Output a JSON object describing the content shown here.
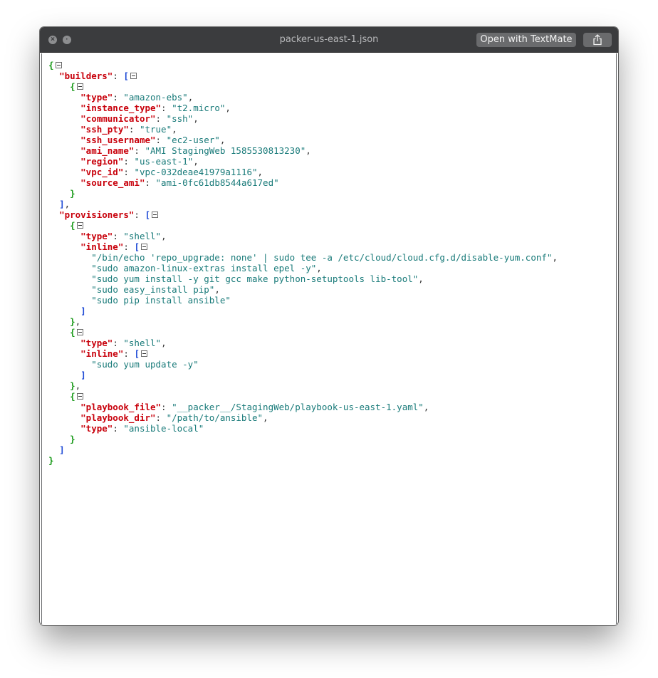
{
  "window": {
    "title": "packer-us-east-1.json",
    "open_with_label": "Open with TextMate",
    "close_icon": "close-icon",
    "minimize_icon": "minimize-icon",
    "share_icon": "share-icon"
  },
  "lines": [
    {
      "indent": 0,
      "tokens": [
        {
          "c": "bc",
          "t": "{"
        },
        {
          "tog": true
        }
      ]
    },
    {
      "indent": 1,
      "tokens": [
        {
          "c": "k",
          "t": "\"builders\""
        },
        {
          "c": "p",
          "t": ": "
        },
        {
          "c": "bs",
          "t": "["
        },
        {
          "tog": true
        }
      ]
    },
    {
      "indent": 2,
      "tokens": [
        {
          "c": "bc",
          "t": "{"
        },
        {
          "tog": true
        }
      ]
    },
    {
      "indent": 3,
      "tokens": [
        {
          "c": "k",
          "t": "\"type\""
        },
        {
          "c": "p",
          "t": ": "
        },
        {
          "c": "s",
          "t": "\"amazon-ebs\""
        },
        {
          "c": "p",
          "t": ","
        }
      ]
    },
    {
      "indent": 3,
      "tokens": [
        {
          "c": "k",
          "t": "\"instance_type\""
        },
        {
          "c": "p",
          "t": ": "
        },
        {
          "c": "s",
          "t": "\"t2.micro\""
        },
        {
          "c": "p",
          "t": ","
        }
      ]
    },
    {
      "indent": 3,
      "tokens": [
        {
          "c": "k",
          "t": "\"communicator\""
        },
        {
          "c": "p",
          "t": ": "
        },
        {
          "c": "s",
          "t": "\"ssh\""
        },
        {
          "c": "p",
          "t": ","
        }
      ]
    },
    {
      "indent": 3,
      "tokens": [
        {
          "c": "k",
          "t": "\"ssh_pty\""
        },
        {
          "c": "p",
          "t": ": "
        },
        {
          "c": "s",
          "t": "\"true\""
        },
        {
          "c": "p",
          "t": ","
        }
      ]
    },
    {
      "indent": 3,
      "tokens": [
        {
          "c": "k",
          "t": "\"ssh_username\""
        },
        {
          "c": "p",
          "t": ": "
        },
        {
          "c": "s",
          "t": "\"ec2-user\""
        },
        {
          "c": "p",
          "t": ","
        }
      ]
    },
    {
      "indent": 3,
      "tokens": [
        {
          "c": "k",
          "t": "\"ami_name\""
        },
        {
          "c": "p",
          "t": ": "
        },
        {
          "c": "s",
          "t": "\"AMI StagingWeb 1585530813230\""
        },
        {
          "c": "p",
          "t": ","
        }
      ]
    },
    {
      "indent": 3,
      "tokens": [
        {
          "c": "k",
          "t": "\"region\""
        },
        {
          "c": "p",
          "t": ": "
        },
        {
          "c": "s",
          "t": "\"us-east-1\""
        },
        {
          "c": "p",
          "t": ","
        }
      ]
    },
    {
      "indent": 3,
      "tokens": [
        {
          "c": "k",
          "t": "\"vpc_id\""
        },
        {
          "c": "p",
          "t": ": "
        },
        {
          "c": "s",
          "t": "\"vpc-032deae41979a1116\""
        },
        {
          "c": "p",
          "t": ","
        }
      ]
    },
    {
      "indent": 3,
      "tokens": [
        {
          "c": "k",
          "t": "\"source_ami\""
        },
        {
          "c": "p",
          "t": ": "
        },
        {
          "c": "s",
          "t": "\"ami-0fc61db8544a617ed\""
        }
      ]
    },
    {
      "indent": 2,
      "tokens": [
        {
          "c": "bc",
          "t": "}"
        }
      ]
    },
    {
      "indent": 1,
      "tokens": [
        {
          "c": "bs",
          "t": "]"
        },
        {
          "c": "p",
          "t": ","
        }
      ]
    },
    {
      "indent": 1,
      "tokens": [
        {
          "c": "k",
          "t": "\"provisioners\""
        },
        {
          "c": "p",
          "t": ": "
        },
        {
          "c": "bs",
          "t": "["
        },
        {
          "tog": true
        }
      ]
    },
    {
      "indent": 2,
      "tokens": [
        {
          "c": "bc",
          "t": "{"
        },
        {
          "tog": true
        }
      ]
    },
    {
      "indent": 3,
      "tokens": [
        {
          "c": "k",
          "t": "\"type\""
        },
        {
          "c": "p",
          "t": ": "
        },
        {
          "c": "s",
          "t": "\"shell\""
        },
        {
          "c": "p",
          "t": ","
        }
      ]
    },
    {
      "indent": 3,
      "tokens": [
        {
          "c": "k",
          "t": "\"inline\""
        },
        {
          "c": "p",
          "t": ": "
        },
        {
          "c": "bs",
          "t": "["
        },
        {
          "tog": true
        }
      ]
    },
    {
      "indent": 4,
      "tokens": [
        {
          "c": "s",
          "t": "\"/bin/echo 'repo_upgrade: none' | sudo tee -a /etc/cloud/cloud.cfg.d/disable-yum.conf\""
        },
        {
          "c": "p",
          "t": ","
        }
      ]
    },
    {
      "indent": 4,
      "tokens": [
        {
          "c": "s",
          "t": "\"sudo amazon-linux-extras install epel -y\""
        },
        {
          "c": "p",
          "t": ","
        }
      ]
    },
    {
      "indent": 4,
      "tokens": [
        {
          "c": "s",
          "t": "\"sudo yum install -y git gcc make python-setuptools lib-tool\""
        },
        {
          "c": "p",
          "t": ","
        }
      ]
    },
    {
      "indent": 4,
      "tokens": [
        {
          "c": "s",
          "t": "\"sudo easy_install pip\""
        },
        {
          "c": "p",
          "t": ","
        }
      ]
    },
    {
      "indent": 4,
      "tokens": [
        {
          "c": "s",
          "t": "\"sudo pip install ansible\""
        }
      ]
    },
    {
      "indent": 3,
      "tokens": [
        {
          "c": "bs",
          "t": "]"
        }
      ]
    },
    {
      "indent": 2,
      "tokens": [
        {
          "c": "bc",
          "t": "}"
        },
        {
          "c": "p",
          "t": ","
        }
      ]
    },
    {
      "indent": 2,
      "tokens": [
        {
          "c": "bc",
          "t": "{"
        },
        {
          "tog": true
        }
      ]
    },
    {
      "indent": 3,
      "tokens": [
        {
          "c": "k",
          "t": "\"type\""
        },
        {
          "c": "p",
          "t": ": "
        },
        {
          "c": "s",
          "t": "\"shell\""
        },
        {
          "c": "p",
          "t": ","
        }
      ]
    },
    {
      "indent": 3,
      "tokens": [
        {
          "c": "k",
          "t": "\"inline\""
        },
        {
          "c": "p",
          "t": ": "
        },
        {
          "c": "bs",
          "t": "["
        },
        {
          "tog": true
        }
      ]
    },
    {
      "indent": 4,
      "tokens": [
        {
          "c": "s",
          "t": "\"sudo yum update -y\""
        }
      ]
    },
    {
      "indent": 3,
      "tokens": [
        {
          "c": "bs",
          "t": "]"
        }
      ]
    },
    {
      "indent": 2,
      "tokens": [
        {
          "c": "bc",
          "t": "}"
        },
        {
          "c": "p",
          "t": ","
        }
      ]
    },
    {
      "indent": 2,
      "tokens": [
        {
          "c": "bc",
          "t": "{"
        },
        {
          "tog": true
        }
      ]
    },
    {
      "indent": 3,
      "tokens": [
        {
          "c": "k",
          "t": "\"playbook_file\""
        },
        {
          "c": "p",
          "t": ": "
        },
        {
          "c": "s",
          "t": "\"__packer__/StagingWeb/playbook-us-east-1.yaml\""
        },
        {
          "c": "p",
          "t": ","
        }
      ]
    },
    {
      "indent": 3,
      "tokens": [
        {
          "c": "k",
          "t": "\"playbook_dir\""
        },
        {
          "c": "p",
          "t": ": "
        },
        {
          "c": "s",
          "t": "\"/path/to/ansible\""
        },
        {
          "c": "p",
          "t": ","
        }
      ]
    },
    {
      "indent": 3,
      "tokens": [
        {
          "c": "k",
          "t": "\"type\""
        },
        {
          "c": "p",
          "t": ": "
        },
        {
          "c": "s",
          "t": "\"ansible-local\""
        }
      ]
    },
    {
      "indent": 2,
      "tokens": [
        {
          "c": "bc",
          "t": "}"
        }
      ]
    },
    {
      "indent": 1,
      "tokens": [
        {
          "c": "bs",
          "t": "]"
        }
      ]
    },
    {
      "indent": 0,
      "tokens": [
        {
          "c": "bc",
          "t": "}"
        }
      ]
    }
  ]
}
